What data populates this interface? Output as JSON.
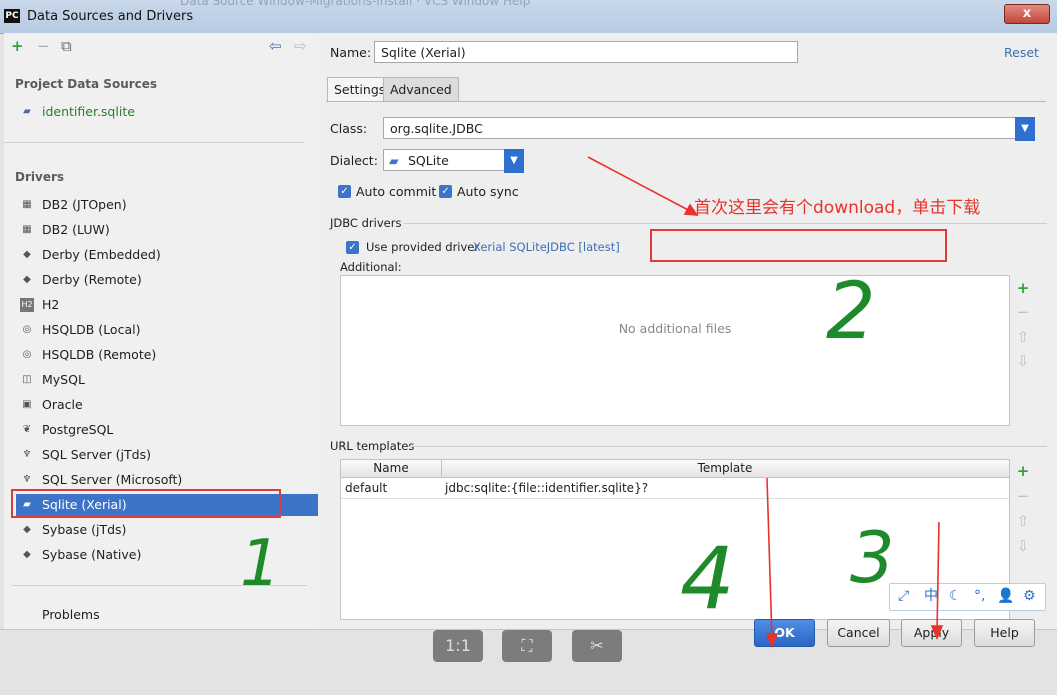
{
  "window": {
    "title": "Data Sources and Drivers",
    "app_icon": "PC",
    "close_label": "x",
    "bg_ghost": "Data Source Window-Migrations-Install  · VCS  Window  Help"
  },
  "left": {
    "toolbar": {
      "add": "+",
      "remove": "−",
      "copy": "⧉",
      "back": "⇦",
      "forward": "⇨"
    },
    "project_header": "Project Data Sources",
    "project_items": [
      {
        "label": "identifier.sqlite",
        "icon": "sqlite-icon"
      }
    ],
    "drivers_header": "Drivers",
    "drivers": [
      {
        "label": "DB2 (JTOpen)",
        "icon": "db2-icon"
      },
      {
        "label": "DB2 (LUW)",
        "icon": "db2-icon"
      },
      {
        "label": "Derby (Embedded)",
        "icon": "derby-icon"
      },
      {
        "label": "Derby (Remote)",
        "icon": "derby-icon"
      },
      {
        "label": "H2",
        "icon": "h2-icon"
      },
      {
        "label": "HSQLDB (Local)",
        "icon": "hsqldb-icon"
      },
      {
        "label": "HSQLDB (Remote)",
        "icon": "hsqldb-icon"
      },
      {
        "label": "MySQL",
        "icon": "mysql-icon"
      },
      {
        "label": "Oracle",
        "icon": "oracle-icon"
      },
      {
        "label": "PostgreSQL",
        "icon": "postgresql-icon"
      },
      {
        "label": "SQL Server (jTds)",
        "icon": "sqlserver-icon"
      },
      {
        "label": "SQL Server (Microsoft)",
        "icon": "sqlserver-icon"
      },
      {
        "label": "Sqlite (Xerial)",
        "icon": "sqlite-icon",
        "selected": true
      },
      {
        "label": "Sybase (jTds)",
        "icon": "sybase-icon"
      },
      {
        "label": "Sybase (Native)",
        "icon": "sybase-icon"
      }
    ],
    "problems": "Problems"
  },
  "right": {
    "name_label": "Name:",
    "name_value": "Sqlite (Xerial)",
    "reset": "Reset",
    "tabs": [
      "Settings",
      "Advanced"
    ],
    "class_label": "Class:",
    "class_value": "org.sqlite.JDBC",
    "dialect_label": "Dialect:",
    "dialect_value": "SQLite",
    "auto_commit": "Auto commit",
    "auto_sync": "Auto sync",
    "jdbc_drivers_header": "JDBC drivers",
    "use_provided": "Use provided driver",
    "driver_link": "Xerial SQLiteJDBC [latest]",
    "additional_label": "Additional:",
    "no_files": "No additional files",
    "url_templates_header": "URL templates",
    "url_columns": [
      "Name",
      "Template"
    ],
    "url_rows": [
      {
        "name": "default",
        "template": "jdbc:sqlite:{file::identifier.sqlite}?"
      }
    ]
  },
  "buttons": {
    "ok": "OK",
    "cancel": "Cancel",
    "apply": "Apply",
    "help": "Help"
  },
  "bottom_tools": [
    "1:1",
    "⛶",
    "✂"
  ],
  "ime_bar": [
    "⤢",
    "中",
    "☾",
    "°,",
    "👤",
    "⚙"
  ],
  "annotations": {
    "note": "首次这里会有个download，单击下载",
    "numbers": [
      "1",
      "2",
      "3",
      "4"
    ],
    "colors": {
      "red": "#e8332a",
      "green": "#1e8a2a"
    }
  }
}
